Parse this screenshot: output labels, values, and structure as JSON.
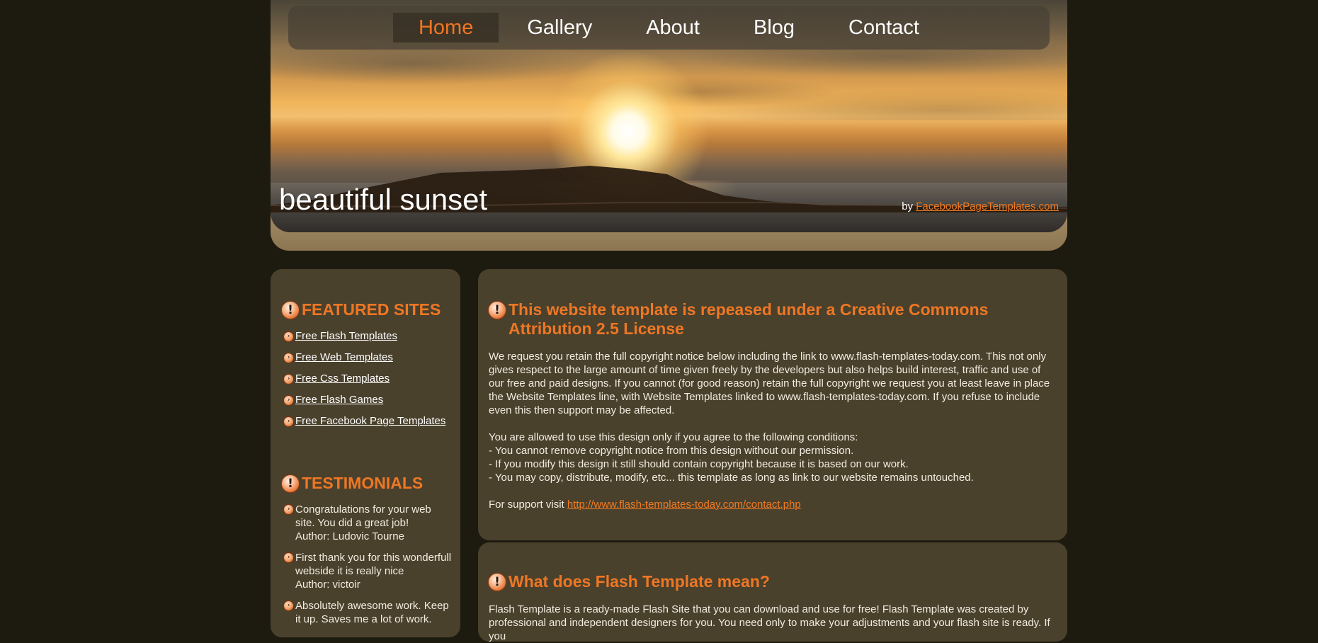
{
  "nav": {
    "items": [
      {
        "label": "Home",
        "active": true
      },
      {
        "label": "Gallery",
        "active": false
      },
      {
        "label": "About",
        "active": false
      },
      {
        "label": "Blog",
        "active": false
      },
      {
        "label": "Contact",
        "active": false
      }
    ]
  },
  "header": {
    "title": "beautiful sunset",
    "by_prefix": "by",
    "by_link": "FacebookPageTemplates.com"
  },
  "sidebar": {
    "featured": {
      "heading": "FEATURED SITES",
      "links": [
        "Free Flash Templates",
        "Free Web Templates",
        "Free Css Templates",
        "Free Flash Games",
        "Free Facebook Page Templates"
      ]
    },
    "testimonials": {
      "heading": "TESTIMONIALS",
      "items": [
        {
          "text": "Congratulations for your web site. You did a great job!",
          "author": "Author: Ludovic Tourne"
        },
        {
          "text": "First thank you for this wonderfull webside it is really nice",
          "author": "Author: victoir"
        },
        {
          "text": "Absolutely awesome work. Keep it up. Saves me a lot of work.",
          "author": ""
        }
      ]
    }
  },
  "main": {
    "license": {
      "heading": "This website template is repeased under a Creative Commons Attribution 2.5 License",
      "p1": "We request you retain the full copyright notice below including the link to www.flash-templates-today.com. This not only gives respect to the large amount of time given freely by the developers but also helps build interest, traffic and use of our free and paid designs. If you cannot (for good reason) retain the full copyright we request you at least leave in place the Website Templates line, with Website Templates linked to www.flash-templates-today.com. If you refuse to include even this then support may be affected.",
      "conditions_intro": "You are allowed to use this design only if you agree to the following conditions:",
      "conditions": [
        "- You cannot remove copyright notice from this design without our permission.",
        "- If you modify this design it still should contain copyright because it is based on our work.",
        "- You may copy, distribute, modify, etc... this template as long as link to our website remains untouched."
      ],
      "support_prefix": "For support visit",
      "support_link": "http://www.flash-templates-today.com/contact.php"
    },
    "flash": {
      "heading": "What does Flash Template mean?",
      "text": "Flash Template is a ready-made Flash Site that you can download and use for free! Flash Template was created by professional and independent designers for you. You need only to make your adjustments and your flash site is ready. If you"
    }
  },
  "colors": {
    "page_bg": "#1d1a0f",
    "panel_bg": "#4a412d",
    "accent_orange": "#ee7724",
    "text": "#f2ece0"
  },
  "icons": {
    "heading_icon": "exclamation-circle-icon",
    "bullet_icon": "chevron-circle-icon"
  }
}
